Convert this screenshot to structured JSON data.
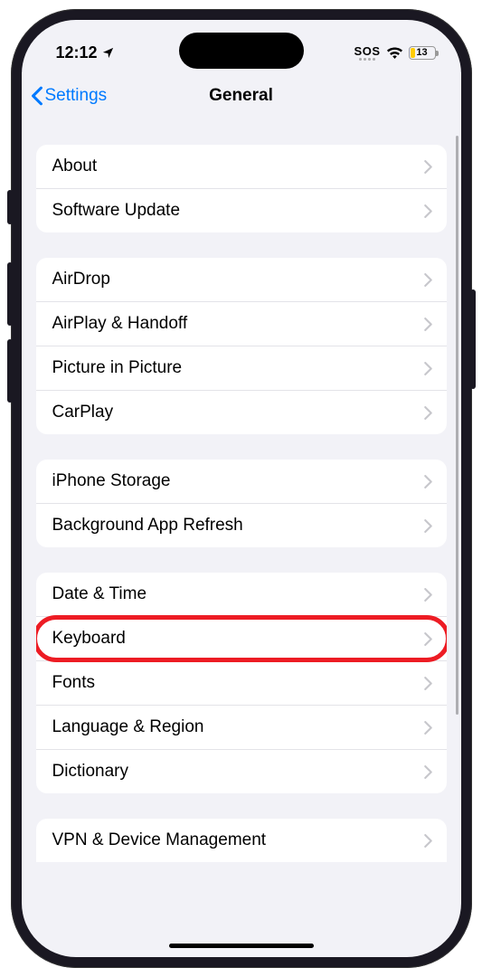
{
  "status": {
    "time": "12:12",
    "sos": "SOS",
    "battery": "13"
  },
  "nav": {
    "back": "Settings",
    "title": "General"
  },
  "groups": [
    {
      "items": [
        "About",
        "Software Update"
      ]
    },
    {
      "items": [
        "AirDrop",
        "AirPlay & Handoff",
        "Picture in Picture",
        "CarPlay"
      ]
    },
    {
      "items": [
        "iPhone Storage",
        "Background App Refresh"
      ]
    },
    {
      "items": [
        "Date & Time",
        "Keyboard",
        "Fonts",
        "Language & Region",
        "Dictionary"
      ]
    },
    {
      "items": [
        "VPN & Device Management"
      ]
    }
  ],
  "highlighted": "Keyboard"
}
